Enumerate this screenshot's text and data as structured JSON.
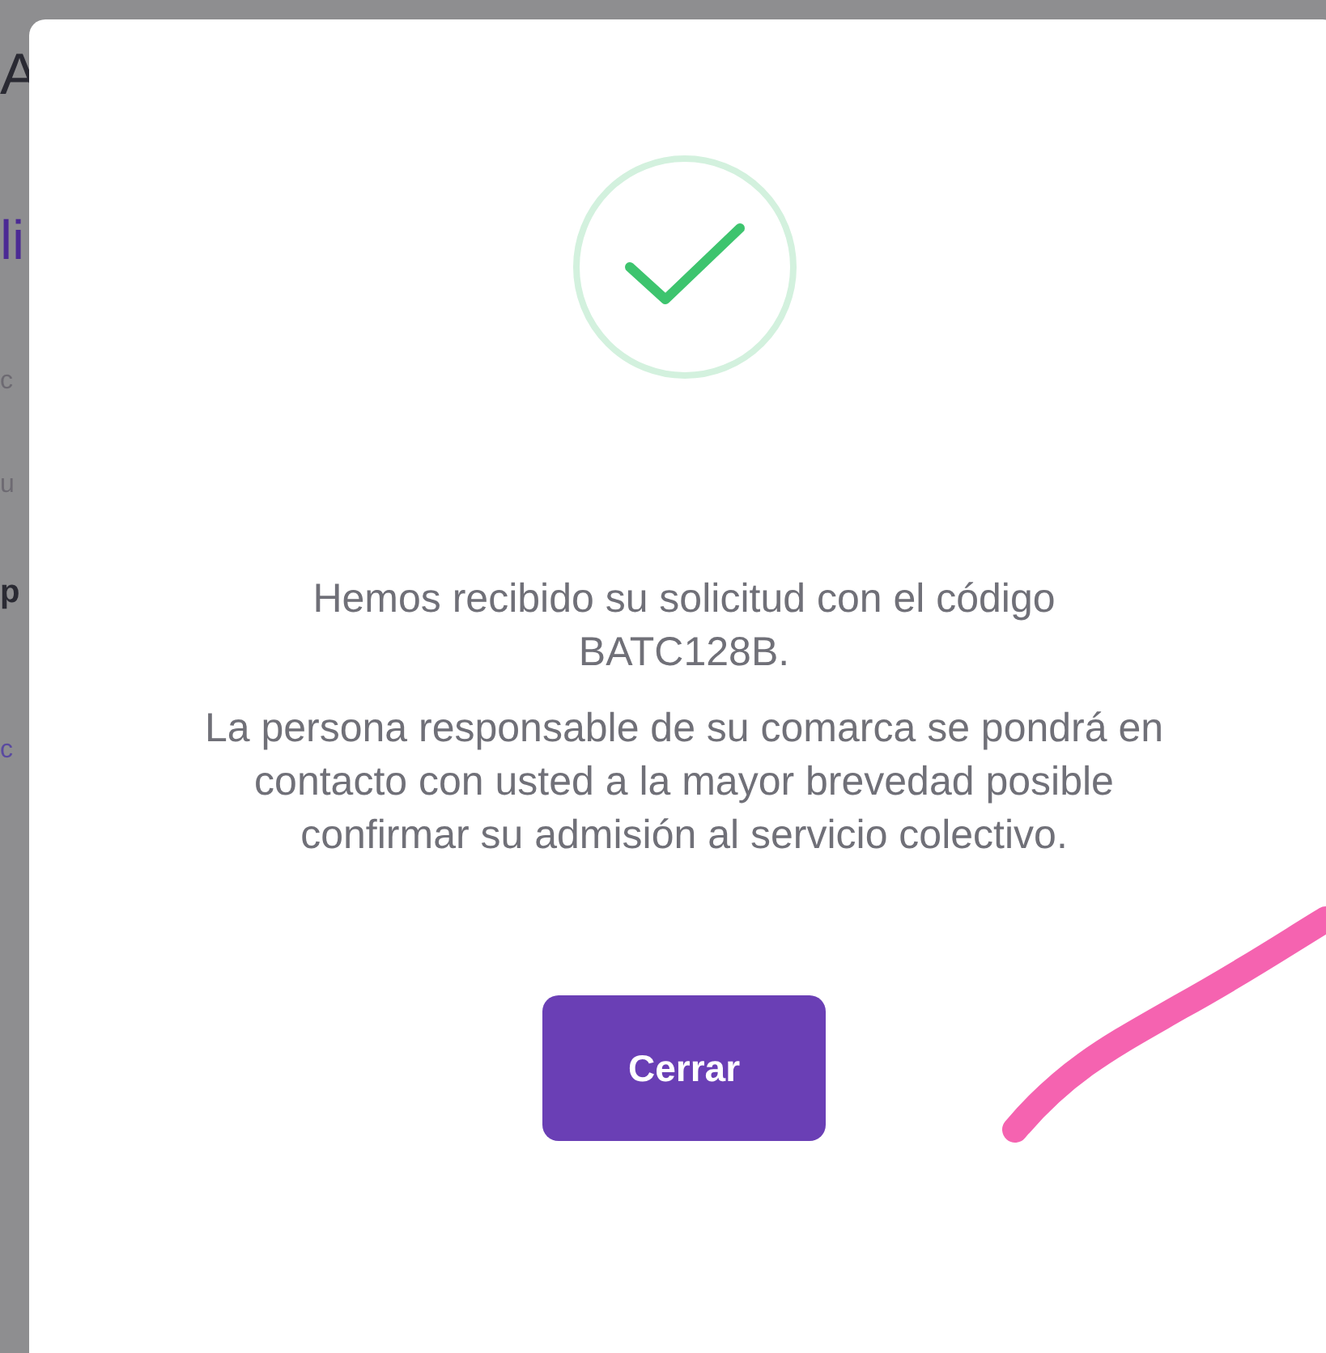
{
  "background_fragments": [
    {
      "text": "A",
      "kind": "title"
    },
    {
      "text": "li",
      "kind": "heading"
    },
    {
      "text": "c",
      "kind": "muted"
    },
    {
      "text": "u",
      "kind": "muted"
    },
    {
      "text": "p",
      "kind": "label"
    },
    {
      "text": "c",
      "kind": "link"
    }
  ],
  "dialog": {
    "message": "Hemos recibido su solicitud con el código BATC128B.",
    "detail": "La persona responsable de su comarca se pondrá en contacto con usted a la mayor brevedad posible confirmar su admisión al servicio colectivo.",
    "button": "Cerrar"
  },
  "annotation": {
    "kind": "stroke",
    "color": "#f563b0"
  }
}
